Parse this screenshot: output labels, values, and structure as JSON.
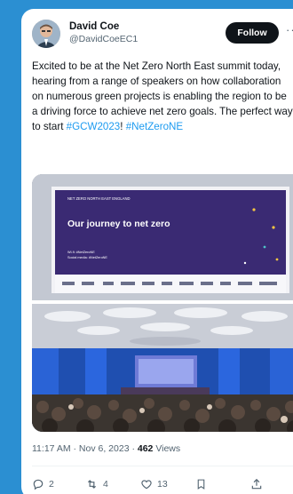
{
  "author": {
    "display_name": "David Coe",
    "handle": "@DavidCoeEC1"
  },
  "follow_label": "Follow",
  "more_label": "···",
  "tweet": {
    "text_main": "Excited to be at the Net Zero North East summit today, hearing from a range of speakers on how collaboration on numerous green projects is enabling the region to be a driving force to achieve net zero goals. The perfect way to start ",
    "hashtag1": "#GCW2023",
    "between": "! ",
    "hashtag2": "#NetZeroNE"
  },
  "slide": {
    "header": "NET ZERO NORTH EAST ENGLAND",
    "title": "Our journey to net zero",
    "line1": "Wi-fi: #NetZeroNE",
    "line2": "Social media: #NetZeroNE"
  },
  "meta": {
    "time": "11:17 AM · Nov 6, 2023 · ",
    "views_count": "462",
    "views_label": " Views"
  },
  "actions": {
    "replies": "2",
    "retweets": "4",
    "likes": "13"
  },
  "colors": {
    "background": "#2b8fd2",
    "link": "#1d9bf0",
    "slide_purple": "#3a2a73"
  }
}
